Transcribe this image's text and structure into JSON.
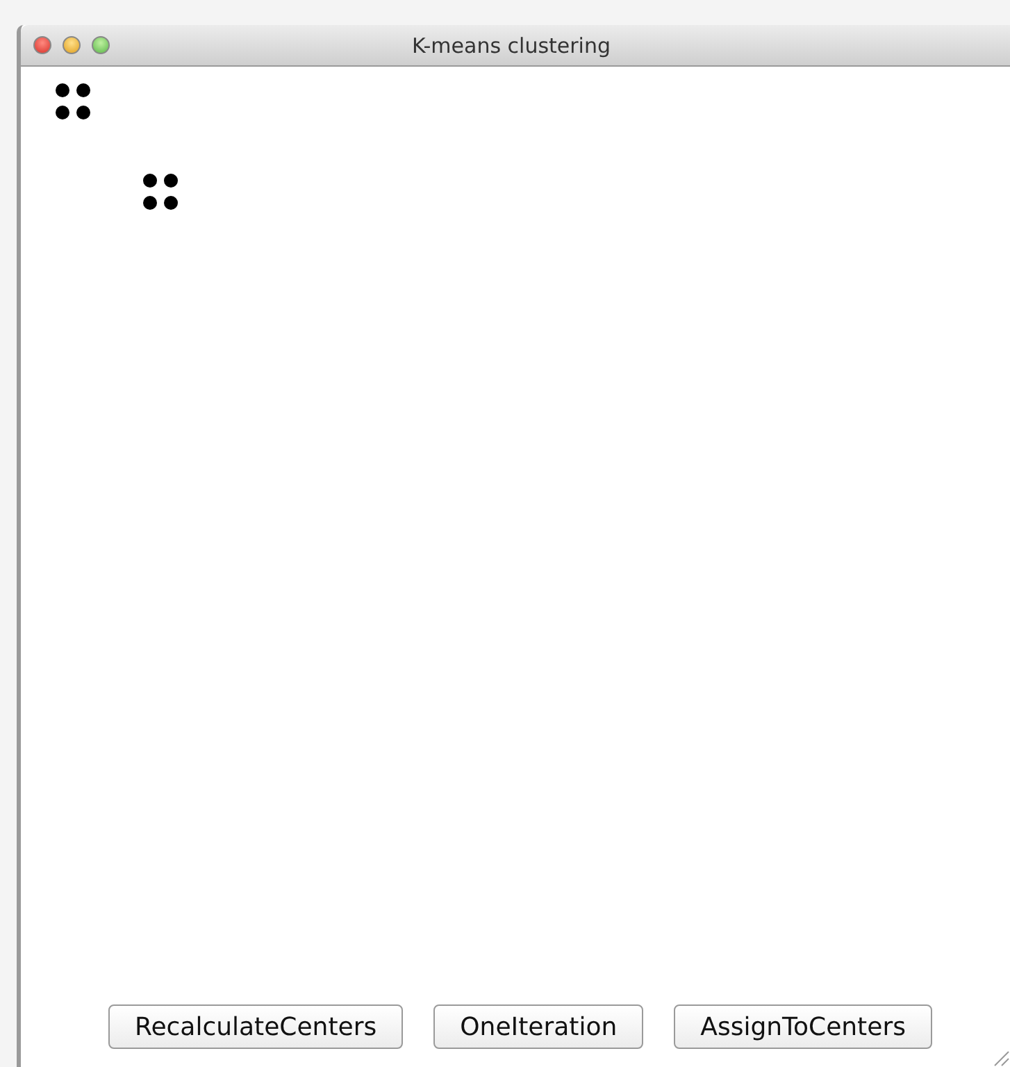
{
  "window": {
    "title": "K-means clustering"
  },
  "buttons": [
    {
      "label": "RecalculateCenters"
    },
    {
      "label": "OneIteration"
    },
    {
      "label": "AssignToCenters"
    }
  ]
}
